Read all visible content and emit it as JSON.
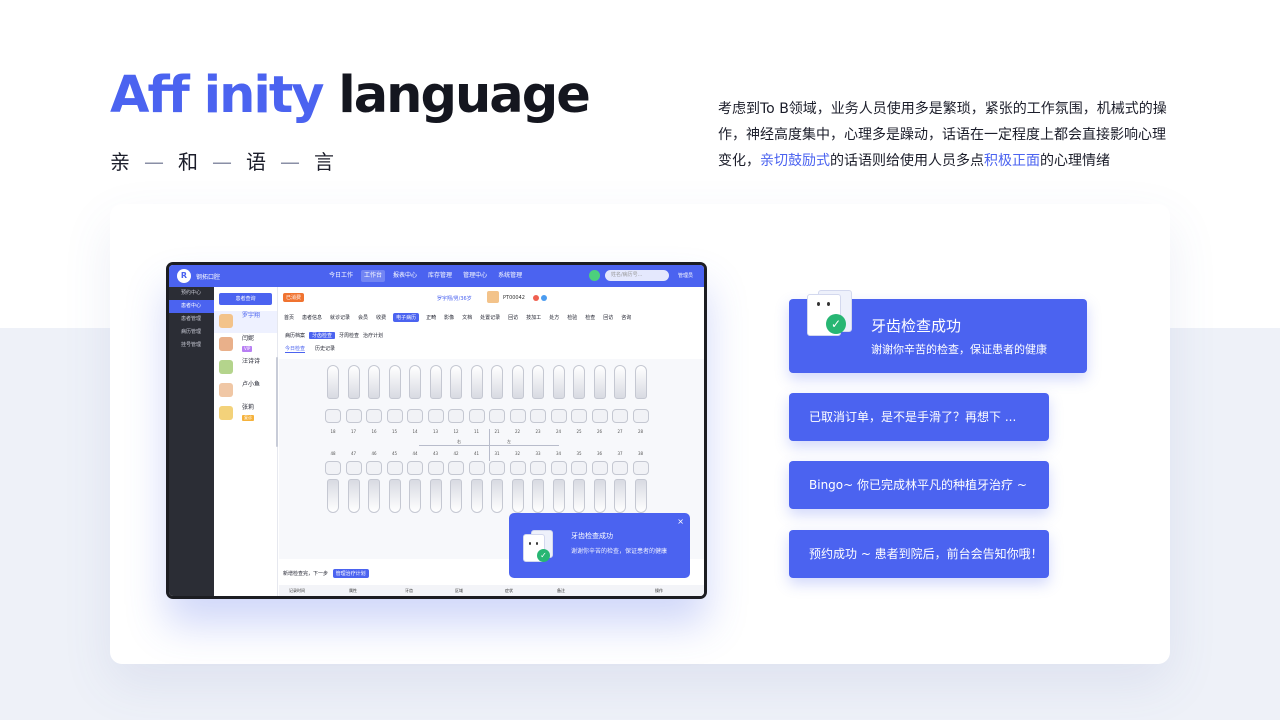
{
  "header": {
    "title_accent": "Aff inity",
    "title_rest": "language",
    "subtitle_chars": [
      "亲",
      "和",
      "语",
      "言"
    ],
    "subtitle_sep": "—"
  },
  "description": {
    "part1": "考虑到To B领域，业务人员使用多是繁琐，紧张的工作氛围，机械式的操作，神经高度集中，心理多是躁动，话语在一定程度上都会直接影响心理变化，",
    "highlight1": "亲切鼓励式",
    "part2": "的话语则给使用人员多点",
    "highlight2": "积极正面",
    "part3": "的心理情绪"
  },
  "app": {
    "brand": "钢拓口腔",
    "logo_glyph": "R",
    "nav": [
      "今日工作",
      "工作台",
      "报表中心",
      "库存管理",
      "管理中心",
      "系统管理"
    ],
    "nav_active_index": 1,
    "search_placeholder": "姓名/病历号...",
    "user": "管理员",
    "sidebar": [
      "预约中心",
      "患者中心",
      "患者管理",
      "病历管理",
      "挂号管理"
    ],
    "sidebar_active_index": 1,
    "patient_search_button": "患者查询",
    "patients": [
      {
        "name": "罗宇翔",
        "tag": ""
      },
      {
        "name": "闫妮",
        "tag": "VIP"
      },
      {
        "name": "汪诗诗",
        "tag": ""
      },
      {
        "name": "卢小鱼",
        "tag": ""
      },
      {
        "name": "张莉",
        "tag": "复诊"
      }
    ],
    "status_badge": "已消费",
    "patient_info": "罗宇翔/男/36岁",
    "patient_id": "PT00042",
    "tabs": [
      "首页",
      "患者信息",
      "就诊记录",
      "会员",
      "收费",
      "电子病历",
      "正畸",
      "影像",
      "文档",
      "处置记录",
      "回访",
      "技加工",
      "处方",
      "检验",
      "检查",
      "回访",
      "咨询"
    ],
    "tabs_active_index": 5,
    "subtabs": [
      "病历档案",
      "牙齿检查",
      "牙周检查",
      "治疗计划"
    ],
    "subtabs_active_index": 1,
    "viewtabs": [
      "今日检查",
      "历史记录"
    ],
    "viewtabs_active_index": 0,
    "upper_numbers": [
      "18",
      "17",
      "16",
      "15",
      "14",
      "13",
      "12",
      "11",
      "21",
      "22",
      "23",
      "24",
      "25",
      "26",
      "27",
      "28"
    ],
    "lower_numbers": [
      "48",
      "47",
      "46",
      "45",
      "44",
      "43",
      "42",
      "41",
      "31",
      "32",
      "33",
      "34",
      "35",
      "36",
      "37",
      "38"
    ],
    "quadrant_right": "右",
    "quadrant_left": "左",
    "new_check_text": "新增检查完，下一步",
    "manage_plan_button": "管理治疗计划",
    "table_headers": [
      "记录时间",
      "属性",
      "牙齿",
      "区域",
      "症状",
      "备注",
      "操作"
    ],
    "mini_toast": {
      "title": "牙齿检查成功",
      "body": "谢谢你辛苦的检查，保证患者的健康",
      "close": "×"
    }
  },
  "toasts": {
    "main": {
      "title": "牙齿检查成功",
      "body": "谢谢你辛苦的检查，保证患者的健康"
    },
    "items": [
      "已取消订单，是不是手滑了？再想下 ...",
      "Bingo~ 你已完成林平凡的种植牙治疗 ~",
      "预约成功 ~ 患者到院后，前台会告知你哦！"
    ]
  },
  "colors": {
    "accent": "#4b63f0",
    "dark": "#14161f",
    "sidebar": "#2b2d35",
    "success": "#27b673"
  }
}
